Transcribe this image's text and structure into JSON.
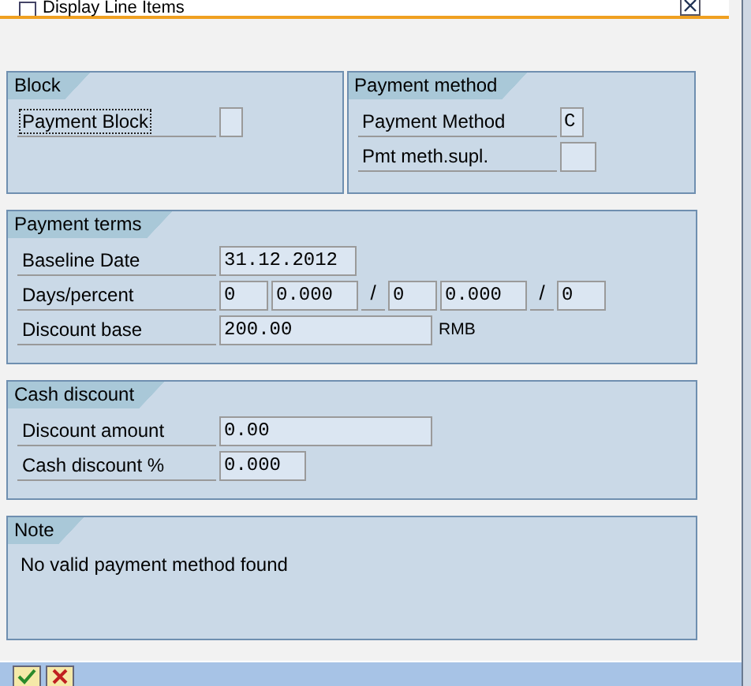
{
  "window": {
    "title": "Display Line Items"
  },
  "groups": [
    {
      "title": "Block",
      "kind": "fields",
      "rows": [
        {
          "label": "Payment Block",
          "focused": true,
          "fields": [
            {
              "kind": "input"
            }
          ]
        }
      ]
    },
    {
      "title": "Payment method",
      "kind": "fields",
      "rows": [
        {
          "label": "Payment Method",
          "focused": false,
          "fields": [
            {
              "kind": "input",
              "value": "C"
            }
          ]
        },
        {
          "label": "Pmt meth.supl.",
          "focused": false,
          "fields": [
            {
              "kind": "input"
            }
          ]
        }
      ]
    },
    {
      "title": "Payment terms",
      "kind": "fields",
      "rows": [
        {
          "label": "Baseline Date",
          "focused": false,
          "fields": [
            {
              "kind": "input",
              "value": "31.12.2012"
            }
          ]
        },
        {
          "label": "Days/percent",
          "focused": false,
          "fields": [
            {
              "kind": "input",
              "value": "0"
            },
            {
              "kind": "input",
              "value": "0.000"
            },
            {
              "kind": "separator",
              "value": "/"
            },
            {
              "kind": "input",
              "value": "0"
            },
            {
              "kind": "input",
              "value": "0.000"
            },
            {
              "kind": "separator",
              "value": "/"
            },
            {
              "kind": "input",
              "value": "0"
            }
          ]
        },
        {
          "label": "Discount base",
          "focused": false,
          "fields": [
            {
              "kind": "input",
              "value": "200.00"
            }
          ],
          "unit": "RMB"
        }
      ]
    },
    {
      "title": "Cash discount",
      "kind": "fields",
      "rows": [
        {
          "label": "Discount amount",
          "focused": false,
          "fields": [
            {
              "kind": "input",
              "value": "0.00"
            }
          ]
        },
        {
          "label": "Cash discount %",
          "focused": false,
          "fields": [
            {
              "kind": "input",
              "value": "0.000"
            }
          ]
        }
      ]
    },
    {
      "title": "Note",
      "kind": "text",
      "text": "No valid payment method found"
    }
  ]
}
